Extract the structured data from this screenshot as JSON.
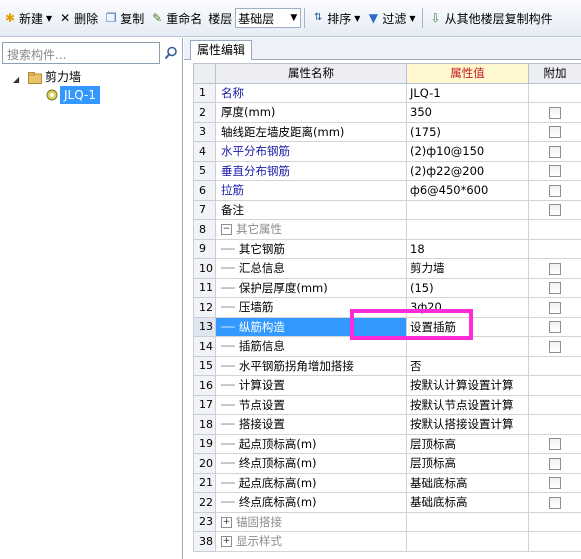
{
  "toolbar": {
    "new_label": "新建",
    "delete_label": "删除",
    "copy_label": "复制",
    "rename_label": "重命名",
    "floor_label": "楼层",
    "floor_value": "基础层",
    "sort_label": "排序",
    "filter_label": "过滤",
    "copy_from_floor_label": "从其他楼层复制构件"
  },
  "left_panel": {
    "search_placeholder": "搜索构件...",
    "tree": {
      "root_label": "剪力墙",
      "child_label": "JLQ-1"
    }
  },
  "tab_label": "属性编辑",
  "grid": {
    "headers": {
      "name": "属性名称",
      "value": "属性值",
      "extra": "附加"
    },
    "rows": [
      {
        "num": "1",
        "name": "名称",
        "value": "JLQ-1"
      },
      {
        "num": "2",
        "name": "厚度(mm)",
        "value": "350"
      },
      {
        "num": "3",
        "name": "轴线距左墙皮距离(mm)",
        "value": "(175)"
      },
      {
        "num": "4",
        "name": "水平分布钢筋",
        "value": "(2)ф10@150"
      },
      {
        "num": "5",
        "name": "垂直分布钢筋",
        "value": "(2)ф22@200"
      },
      {
        "num": "6",
        "name": "拉筋",
        "value": "ф6@450*600"
      },
      {
        "num": "7",
        "name": "备注",
        "value": ""
      },
      {
        "num": "8",
        "name": "其它属性",
        "value": ""
      },
      {
        "num": "9",
        "name": "其它钢筋",
        "value": "18"
      },
      {
        "num": "10",
        "name": "汇总信息",
        "value": "剪力墙"
      },
      {
        "num": "11",
        "name": "保护层厚度(mm)",
        "value": "(15)"
      },
      {
        "num": "12",
        "name": "压墙筋",
        "value": "3ф20"
      },
      {
        "num": "13",
        "name": "纵筋构造",
        "value": "设置插筋"
      },
      {
        "num": "14",
        "name": "插筋信息",
        "value": ""
      },
      {
        "num": "15",
        "name": "水平钢筋拐角增加搭接",
        "value": "否"
      },
      {
        "num": "16",
        "name": "计算设置",
        "value": "按默认计算设置计算"
      },
      {
        "num": "17",
        "name": "节点设置",
        "value": "按默认节点设置计算"
      },
      {
        "num": "18",
        "name": "搭接设置",
        "value": "按默认搭接设置计算"
      },
      {
        "num": "19",
        "name": "起点顶标高(m)",
        "value": "层顶标高"
      },
      {
        "num": "20",
        "name": "终点顶标高(m)",
        "value": "层顶标高"
      },
      {
        "num": "21",
        "name": "起点底标高(m)",
        "value": "基础底标高"
      },
      {
        "num": "22",
        "name": "终点底标高(m)",
        "value": "基础底标高"
      },
      {
        "num": "23",
        "name": "锚固搭接",
        "value": ""
      },
      {
        "num": "38",
        "name": "显示样式",
        "value": ""
      }
    ]
  },
  "colors": {
    "highlight": "#ff2bd6",
    "selection": "#3399ff",
    "value_header": "#c21a1a",
    "blue_text": "#1a1aa8"
  }
}
